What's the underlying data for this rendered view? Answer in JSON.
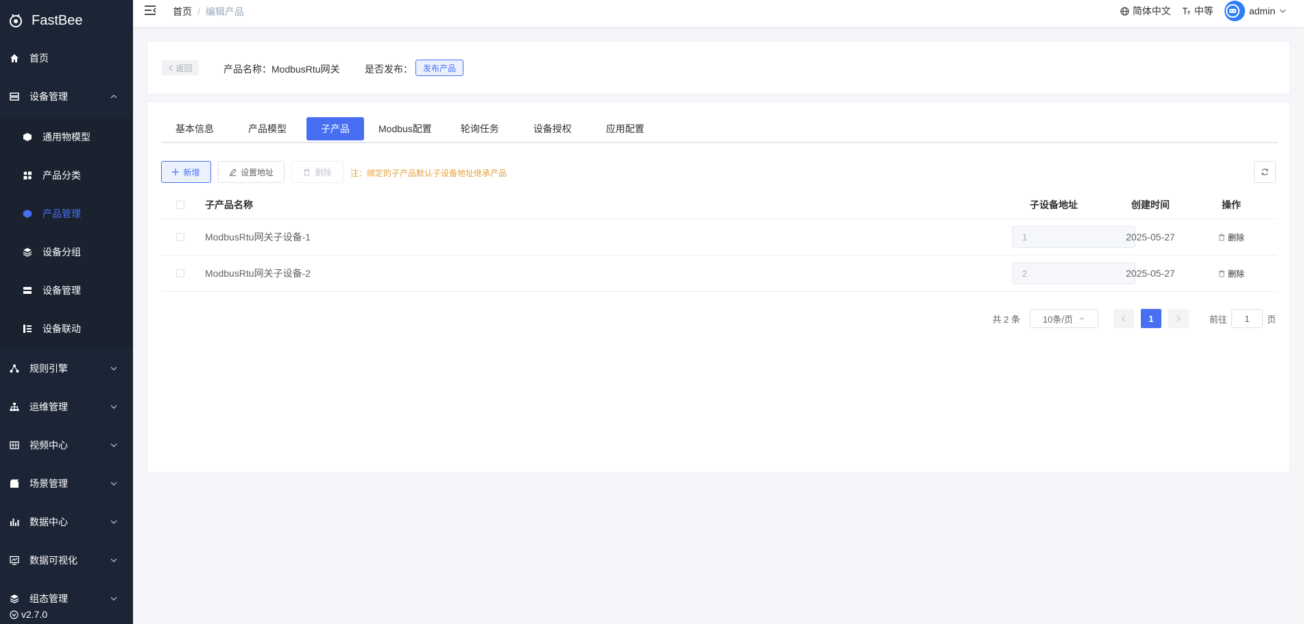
{
  "app": {
    "name": "FastBee",
    "version": "v2.7.0"
  },
  "colors": {
    "sidebar_bg": "#1c2535",
    "accent": "#486ff2",
    "note": "#e6a23c"
  },
  "sidebar": {
    "items": [
      {
        "label": "首页",
        "icon": "home-icon"
      },
      {
        "label": "设备管理",
        "icon": "server-icon",
        "expanded": true,
        "children": [
          {
            "label": "通用物模型",
            "icon": "cube-icon"
          },
          {
            "label": "产品分类",
            "icon": "category-icon"
          },
          {
            "label": "产品管理",
            "icon": "cube-icon",
            "active": true
          },
          {
            "label": "设备分组",
            "icon": "layers-icon"
          },
          {
            "label": "设备管理",
            "icon": "server-icon"
          },
          {
            "label": "设备联动",
            "icon": "linkage-icon"
          }
        ]
      },
      {
        "label": "规则引擎",
        "icon": "rule-icon"
      },
      {
        "label": "运维管理",
        "icon": "tree-icon"
      },
      {
        "label": "视频中心",
        "icon": "grid-icon"
      },
      {
        "label": "场景管理",
        "icon": "scene-icon"
      },
      {
        "label": "数据中心",
        "icon": "chart-icon"
      },
      {
        "label": "数据可视化",
        "icon": "monitor-icon"
      },
      {
        "label": "组态管理",
        "icon": "layers-icon"
      }
    ]
  },
  "header": {
    "breadcrumb": {
      "home": "首页",
      "separator": "/",
      "current": "编辑产品"
    },
    "language": "简体中文",
    "size": "中等",
    "user": "admin"
  },
  "product": {
    "back_label": "返回",
    "name_label": "产品名称：ModbusRtu网关",
    "publish_label": "是否发布：",
    "publish_button": "发布产品"
  },
  "tabs": [
    {
      "label": "基本信息"
    },
    {
      "label": "产品模型"
    },
    {
      "label": "子产品",
      "active": true
    },
    {
      "label": "Modbus配置"
    },
    {
      "label": "轮询任务"
    },
    {
      "label": "设备授权"
    },
    {
      "label": "应用配置"
    }
  ],
  "toolbar": {
    "add": "新增",
    "set_address": "设置地址",
    "delete": "删除",
    "note": "注：绑定的子产品默认子设备地址继承产品"
  },
  "table": {
    "headers": {
      "name": "子产品名称",
      "address": "子设备地址",
      "created": "创建时间",
      "action": "操作"
    },
    "rows": [
      {
        "name": "ModbusRtu网关子设备-1",
        "address": "1",
        "created": "2025-05-27",
        "action": "删除"
      },
      {
        "name": "ModbusRtu网关子设备-2",
        "address": "2",
        "created": "2025-05-27",
        "action": "删除"
      }
    ]
  },
  "pagination": {
    "total": "共 2 条",
    "page_size": "10条/页",
    "current_page": "1",
    "goto_label": "前往",
    "goto_value": "1",
    "page_suffix": "页"
  }
}
